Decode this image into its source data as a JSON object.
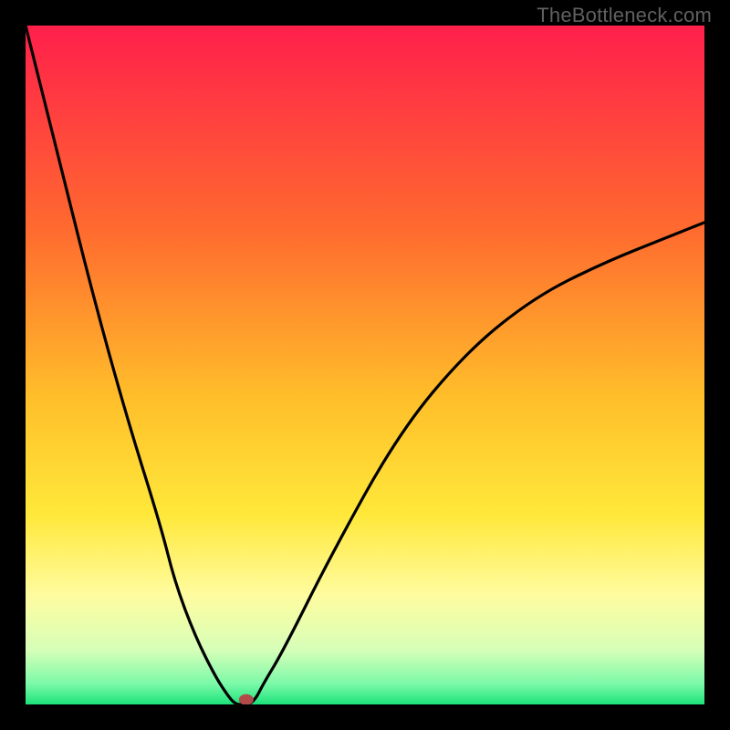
{
  "watermark": "TheBottleneck.com",
  "chart_data": {
    "type": "line",
    "title": "",
    "xlabel": "",
    "ylabel": "",
    "xlim": [
      0,
      100
    ],
    "ylim": [
      0,
      100
    ],
    "series": [
      {
        "name": "bottleneck-curve",
        "x": [
          0,
          5,
          10,
          15,
          20,
          22,
          25,
          28,
          30,
          31,
          32,
          33,
          34,
          35,
          38,
          45,
          55,
          65,
          75,
          85,
          95,
          100
        ],
        "y": [
          100,
          80,
          60,
          42,
          26,
          18,
          10,
          4,
          1,
          0,
          0,
          0,
          1,
          3,
          8,
          22,
          40,
          52,
          60,
          65,
          69,
          71
        ]
      }
    ],
    "marker": {
      "x": 32.5,
      "y": 0.7
    },
    "gradient_stops": [
      {
        "offset": 0,
        "color": "#ff1f4b"
      },
      {
        "offset": 30,
        "color": "#ff6a2f"
      },
      {
        "offset": 55,
        "color": "#ffbf2a"
      },
      {
        "offset": 72,
        "color": "#ffe83a"
      },
      {
        "offset": 84,
        "color": "#fffca0"
      },
      {
        "offset": 92,
        "color": "#d6ffb8"
      },
      {
        "offset": 97,
        "color": "#7af9a8"
      },
      {
        "offset": 100,
        "color": "#1de27a"
      }
    ],
    "curve_color": "#000000",
    "marker_color": "#b24a4a"
  }
}
